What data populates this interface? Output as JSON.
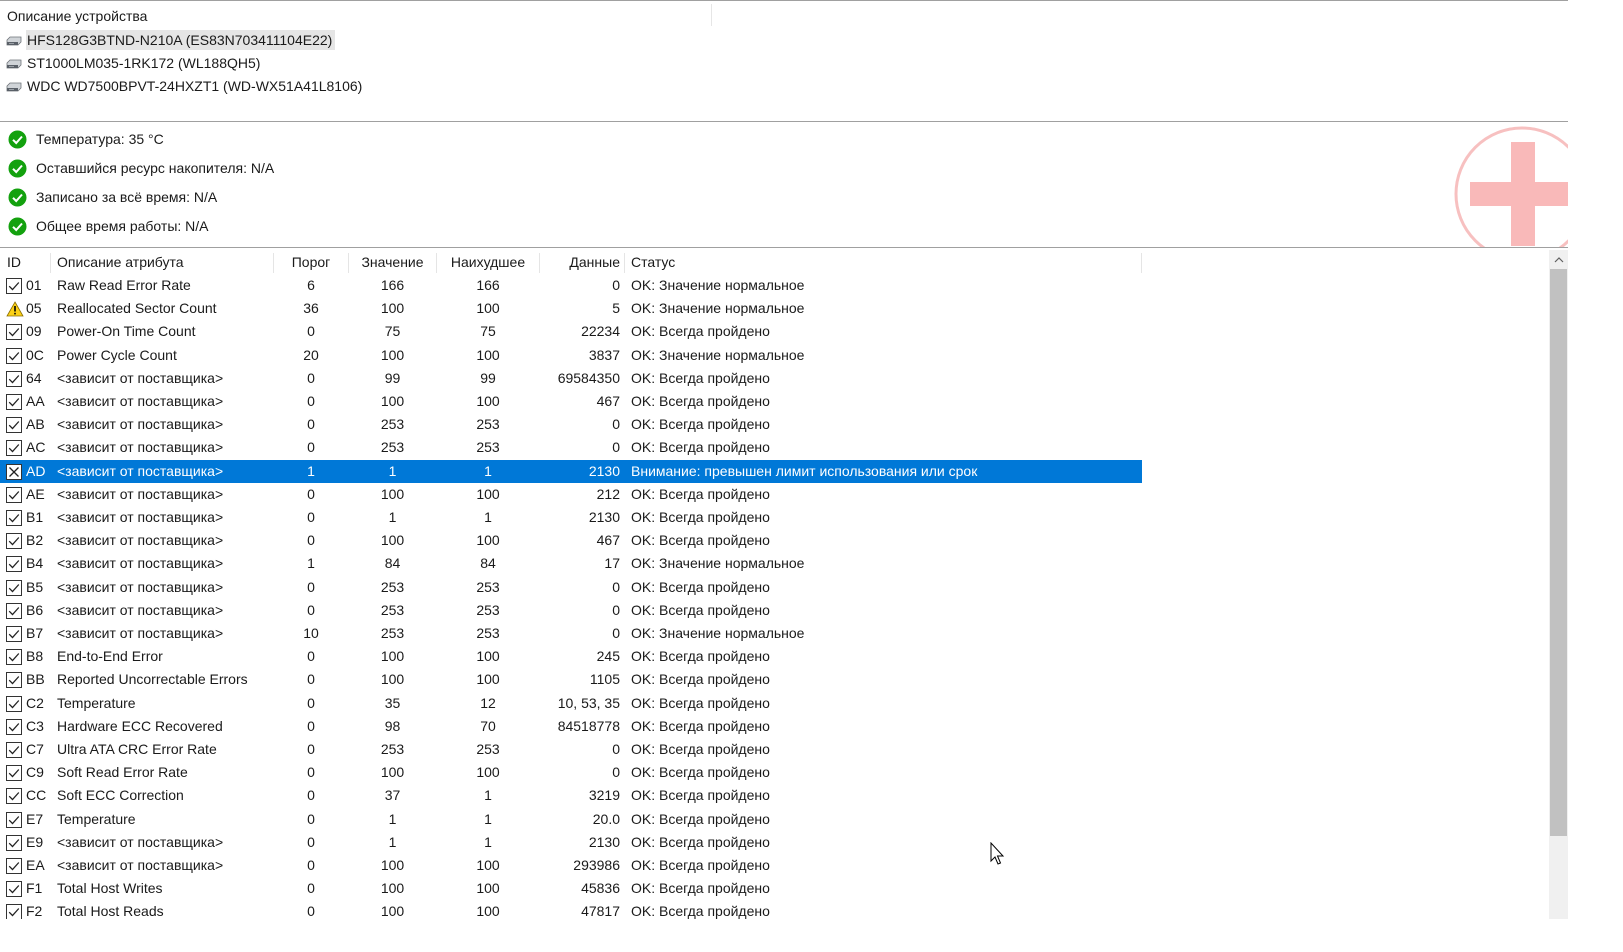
{
  "devices": {
    "header": "Описание устройства",
    "items": [
      {
        "label": "HFS128G3BTND-N210A (ES83N703411104E22)",
        "selected": true
      },
      {
        "label": "ST1000LM035-1RK172 (WL188QH5)",
        "selected": false
      },
      {
        "label": "WDC WD7500BPVT-24HXZT1 (WD-WX51A41L8106)",
        "selected": false
      }
    ]
  },
  "summary": {
    "items": [
      {
        "label": "Температура: 35 °C",
        "icon": "ok-check-icon"
      },
      {
        "label": "Оставшийся ресурс накопителя: N/A",
        "icon": "ok-check-icon"
      },
      {
        "label": "Записано за всё время: N/A",
        "icon": "ok-check-icon"
      },
      {
        "label": "Общее время работы: N/A",
        "icon": "ok-check-icon"
      }
    ]
  },
  "table": {
    "columns": {
      "id": "ID",
      "name": "Описание атрибута",
      "threshold": "Порог",
      "value": "Значение",
      "worst": "Наихудшее",
      "data": "Данные",
      "status": "Статус"
    },
    "rows": [
      {
        "icon": "check",
        "id": "01",
        "name": "Raw Read Error Rate",
        "threshold": "6",
        "value": "166",
        "worst": "166",
        "data": "0",
        "status": "OK: Значение нормальное"
      },
      {
        "icon": "warning",
        "id": "05",
        "name": "Reallocated Sector Count",
        "threshold": "36",
        "value": "100",
        "worst": "100",
        "data": "5",
        "status": "OK: Значение нормальное"
      },
      {
        "icon": "check",
        "id": "09",
        "name": "Power-On Time Count",
        "threshold": "0",
        "value": "75",
        "worst": "75",
        "data": "22234",
        "status": "OK: Всегда пройдено"
      },
      {
        "icon": "check",
        "id": "0C",
        "name": "Power Cycle Count",
        "threshold": "20",
        "value": "100",
        "worst": "100",
        "data": "3837",
        "status": "OK: Значение нормальное"
      },
      {
        "icon": "check",
        "id": "64",
        "name": "<зависит от поставщика>",
        "threshold": "0",
        "value": "99",
        "worst": "99",
        "data": "69584350",
        "status": "OK: Всегда пройдено"
      },
      {
        "icon": "check",
        "id": "AA",
        "name": "<зависит от поставщика>",
        "threshold": "0",
        "value": "100",
        "worst": "100",
        "data": "467",
        "status": "OK: Всегда пройдено"
      },
      {
        "icon": "check",
        "id": "AB",
        "name": "<зависит от поставщика>",
        "threshold": "0",
        "value": "253",
        "worst": "253",
        "data": "0",
        "status": "OK: Всегда пройдено"
      },
      {
        "icon": "check",
        "id": "AC",
        "name": "<зависит от поставщика>",
        "threshold": "0",
        "value": "253",
        "worst": "253",
        "data": "0",
        "status": "OK: Всегда пройдено"
      },
      {
        "icon": "cross",
        "id": "AD",
        "name": "<зависит от поставщика>",
        "threshold": "1",
        "value": "1",
        "worst": "1",
        "data": "2130",
        "status": "Внимание: превышен лимит использования или срок",
        "selected": true
      },
      {
        "icon": "check",
        "id": "AE",
        "name": "<зависит от поставщика>",
        "threshold": "0",
        "value": "100",
        "worst": "100",
        "data": "212",
        "status": "OK: Всегда пройдено"
      },
      {
        "icon": "check",
        "id": "B1",
        "name": "<зависит от поставщика>",
        "threshold": "0",
        "value": "1",
        "worst": "1",
        "data": "2130",
        "status": "OK: Всегда пройдено"
      },
      {
        "icon": "check",
        "id": "B2",
        "name": "<зависит от поставщика>",
        "threshold": "0",
        "value": "100",
        "worst": "100",
        "data": "467",
        "status": "OK: Всегда пройдено"
      },
      {
        "icon": "check",
        "id": "B4",
        "name": "<зависит от поставщика>",
        "threshold": "1",
        "value": "84",
        "worst": "84",
        "data": "17",
        "status": "OK: Значение нормальное"
      },
      {
        "icon": "check",
        "id": "B5",
        "name": "<зависит от поставщика>",
        "threshold": "0",
        "value": "253",
        "worst": "253",
        "data": "0",
        "status": "OK: Всегда пройдено"
      },
      {
        "icon": "check",
        "id": "B6",
        "name": "<зависит от поставщика>",
        "threshold": "0",
        "value": "253",
        "worst": "253",
        "data": "0",
        "status": "OK: Всегда пройдено"
      },
      {
        "icon": "check",
        "id": "B7",
        "name": "<зависит от поставщика>",
        "threshold": "10",
        "value": "253",
        "worst": "253",
        "data": "0",
        "status": "OK: Значение нормальное"
      },
      {
        "icon": "check",
        "id": "B8",
        "name": "End-to-End Error",
        "threshold": "0",
        "value": "100",
        "worst": "100",
        "data": "245",
        "status": "OK: Всегда пройдено"
      },
      {
        "icon": "check",
        "id": "BB",
        "name": "Reported Uncorrectable Errors",
        "threshold": "0",
        "value": "100",
        "worst": "100",
        "data": "1105",
        "status": "OK: Всегда пройдено"
      },
      {
        "icon": "check",
        "id": "C2",
        "name": "Temperature",
        "threshold": "0",
        "value": "35",
        "worst": "12",
        "data": "10, 53, 35",
        "status": "OK: Всегда пройдено"
      },
      {
        "icon": "check",
        "id": "C3",
        "name": "Hardware ECC Recovered",
        "threshold": "0",
        "value": "98",
        "worst": "70",
        "data": "84518778",
        "status": "OK: Всегда пройдено"
      },
      {
        "icon": "check",
        "id": "C7",
        "name": "Ultra ATA CRC Error Rate",
        "threshold": "0",
        "value": "253",
        "worst": "253",
        "data": "0",
        "status": "OK: Всегда пройдено"
      },
      {
        "icon": "check",
        "id": "C9",
        "name": "Soft Read Error Rate",
        "threshold": "0",
        "value": "100",
        "worst": "100",
        "data": "0",
        "status": "OK: Всегда пройдено"
      },
      {
        "icon": "check",
        "id": "CC",
        "name": "Soft ECC Correction",
        "threshold": "0",
        "value": "37",
        "worst": "1",
        "data": "3219",
        "status": "OK: Всегда пройдено"
      },
      {
        "icon": "check",
        "id": "E7",
        "name": "Temperature",
        "threshold": "0",
        "value": "1",
        "worst": "1",
        "data": "20.0",
        "status": "OK: Всегда пройдено"
      },
      {
        "icon": "check",
        "id": "E9",
        "name": "<зависит от поставщика>",
        "threshold": "0",
        "value": "1",
        "worst": "1",
        "data": "2130",
        "status": "OK: Всегда пройдено"
      },
      {
        "icon": "check",
        "id": "EA",
        "name": "<зависит от поставщика>",
        "threshold": "0",
        "value": "100",
        "worst": "100",
        "data": "293986",
        "status": "OK: Всегда пройдено"
      },
      {
        "icon": "check",
        "id": "F1",
        "name": "Total Host Writes",
        "threshold": "0",
        "value": "100",
        "worst": "100",
        "data": "45836",
        "status": "OK: Всегда пройдено"
      },
      {
        "icon": "check",
        "id": "F2",
        "name": "Total Host Reads",
        "threshold": "0",
        "value": "100",
        "worst": "100",
        "data": "47817",
        "status": "OK: Всегда пройдено"
      }
    ]
  },
  "colors": {
    "selection": "#0078d7",
    "ok": "#13a10e",
    "warning": "#fcd116",
    "watermark": "#f7b7b7"
  }
}
